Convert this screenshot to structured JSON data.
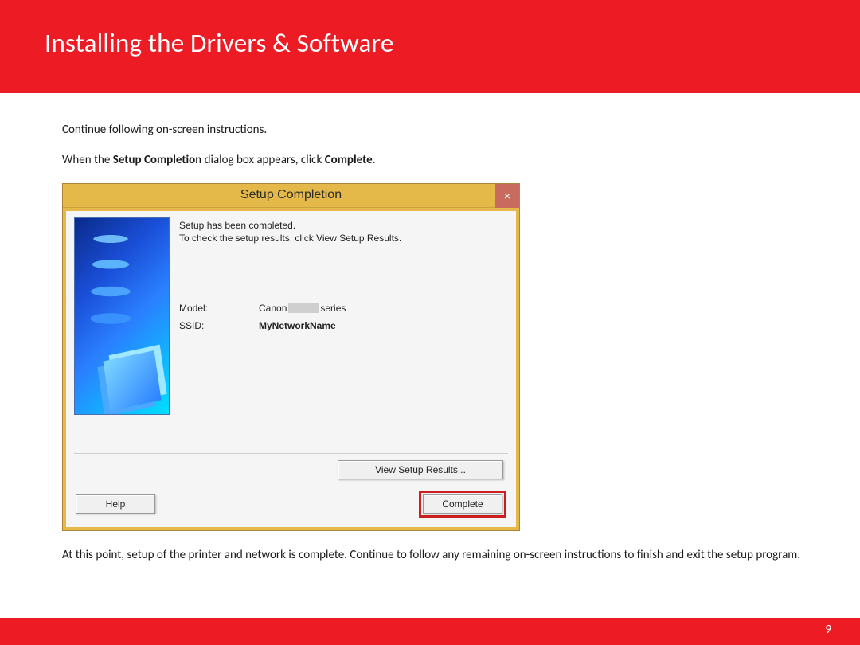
{
  "header": {
    "title": "Installing  the Drivers & Software"
  },
  "body": {
    "line1": "Continue following on-screen instructions.",
    "line2_pre": "When the  ",
    "line2_b1": "Setup Completion",
    "line2_mid": " dialog box appears, click ",
    "line2_b2": "Complete",
    "line2_post": ".",
    "line3": "At this point, setup of the printer and network is complete.  Continue to follow any remaining on-screen instructions to finish and exit the setup program."
  },
  "dialog": {
    "title": "Setup Completion",
    "close_glyph": "×",
    "message_l1": "Setup has been completed.",
    "message_l2": "To check the setup results, click View Setup Results.",
    "model_label": "Model:",
    "model_brand": "Canon",
    "model_suffix": "series",
    "ssid_label": "SSID:",
    "ssid_value": "MyNetworkName",
    "view_setup_results": "View Setup Results...",
    "help": "Help",
    "complete": "Complete"
  },
  "page_number": "9"
}
